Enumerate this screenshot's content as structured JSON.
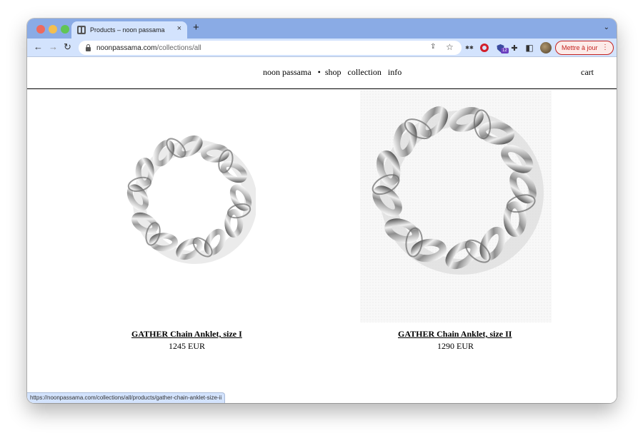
{
  "browser": {
    "tab_title": "Products – noon passama",
    "tab_close": "×",
    "new_tab": "+",
    "tab_menu": "⌄",
    "back": "←",
    "forward": "→",
    "reload": "↻",
    "url_host": "noonpassama.com",
    "url_path": "/collections/all",
    "share_icon": "⇪",
    "star_icon": "☆",
    "ext_asterisks": "✱✱",
    "ext_badge": "12",
    "puzzle_icon": "✚",
    "sidepanel_icon": "◧",
    "update_label": "Mettre à jour",
    "update_menu": "⋮",
    "status_url": "https://noonpassama.com/collections/all/products/gather-chain-anklet-size-ii"
  },
  "site": {
    "nav": {
      "brand": "noon passama",
      "bullet": "•",
      "shop": "shop",
      "collection": "collection",
      "info": "info"
    },
    "cart": "cart"
  },
  "products": [
    {
      "title": "GATHER Chain Anklet, size I",
      "price": "1245 EUR"
    },
    {
      "title": "GATHER Chain Anklet, size II",
      "price": "1290 EUR"
    }
  ],
  "colors": {
    "tabstrip": "#8aabe5",
    "toolbar": "#d3e3fd",
    "update_accent": "#c5221f",
    "link": "#000000"
  }
}
